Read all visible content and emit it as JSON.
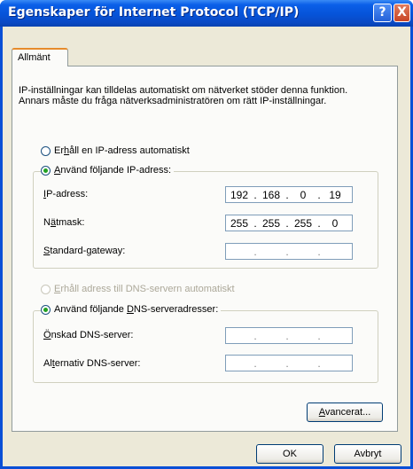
{
  "window": {
    "title": "Egenskaper för Internet Protocol (TCP/IP)",
    "help_label": "?",
    "close_label": "X"
  },
  "tab": {
    "label": "Allmänt"
  },
  "description": "IP-inställningar kan tilldelas automatiskt om nätverket stöder denna funktion. Annars måste du fråga nätverksadministratören om rätt IP-inställningar.",
  "ip_section": {
    "auto_option": {
      "pre": "Er",
      "key": "h",
      "post": "åll en IP-adress automatiskt",
      "selected": false
    },
    "manual_option": {
      "pre": "",
      "key": "A",
      "post": "nvänd följande IP-adress:",
      "selected": true
    },
    "fields": [
      {
        "pre": "",
        "key": "I",
        "post": "P-adress:",
        "octets": [
          "192",
          "168",
          "0",
          "19"
        ]
      },
      {
        "pre": "N",
        "key": "ä",
        "post": "tmask:",
        "octets": [
          "255",
          "255",
          "255",
          "0"
        ]
      },
      {
        "pre": "",
        "key": "S",
        "post": "tandard-gateway:",
        "octets": [
          "",
          "",
          "",
          ""
        ]
      }
    ]
  },
  "dns_section": {
    "auto_option": {
      "pre": "",
      "key": "E",
      "post": "rhåll adress till DNS-servern automatiskt",
      "selected": false,
      "disabled": true
    },
    "manual_option": {
      "pre": "Använd följande ",
      "key": "D",
      "post": "NS-serveradresser:",
      "selected": true
    },
    "fields": [
      {
        "pre": "",
        "key": "Ö",
        "post": "nskad DNS-server:",
        "octets": [
          "",
          "",
          "",
          ""
        ]
      },
      {
        "pre": "Al",
        "key": "t",
        "post": "ernativ DNS-server:",
        "octets": [
          "",
          "",
          "",
          ""
        ]
      }
    ]
  },
  "buttons": {
    "advanced": {
      "pre": "",
      "key": "A",
      "post": "vancerat..."
    },
    "ok": "OK",
    "cancel": "Avbryt"
  }
}
